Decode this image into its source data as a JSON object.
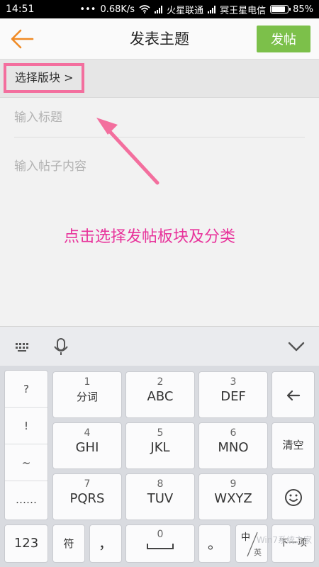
{
  "status_bar": {
    "time": "14:51",
    "speed": "0.68K/s",
    "carrier1": "火星联通",
    "carrier2": "冥王星电信",
    "battery": "85%",
    "battery_level": 0.85
  },
  "header": {
    "title": "发表主题",
    "post_label": "发帖",
    "accent_color": "#7cc04a",
    "back_icon_color": "#f08a24"
  },
  "board_select": {
    "label": "选择版块 >"
  },
  "form": {
    "title_placeholder": "输入标题",
    "content_placeholder": "输入帖子内容"
  },
  "annotation": {
    "text": "点击选择发帖板块及分类",
    "color": "#e8339b"
  },
  "keyboard": {
    "punctuation": [
      "?",
      "!",
      "~",
      "……"
    ],
    "keys": [
      {
        "num": "1",
        "label": "分词"
      },
      {
        "num": "2",
        "label": "ABC"
      },
      {
        "num": "3",
        "label": "DEF"
      },
      {
        "num": "4",
        "label": "GHI"
      },
      {
        "num": "5",
        "label": "JKL"
      },
      {
        "num": "6",
        "label": "MNO"
      },
      {
        "num": "7",
        "label": "PQRS"
      },
      {
        "num": "8",
        "label": "TUV"
      },
      {
        "num": "9",
        "label": "WXYZ"
      }
    ],
    "clear_label": "清空",
    "num_label": "123",
    "symbol_label": "符",
    "comma_label": "，",
    "space_num": "0",
    "period_label": "。",
    "lang_top": "中",
    "lang_bottom": "英",
    "next_label": "下一项"
  },
  "watermark": "Win7系统之家"
}
